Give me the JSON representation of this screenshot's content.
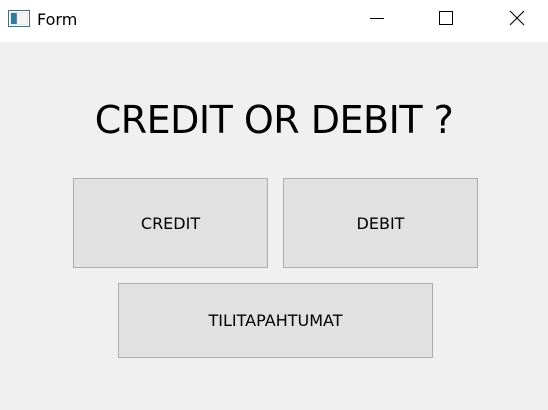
{
  "window": {
    "title": "Form",
    "icon": "form-window-icon",
    "controls": [
      "minimize-icon",
      "maximize-icon",
      "close-icon"
    ]
  },
  "main": {
    "heading": "CREDIT OR DEBIT ?",
    "buttons": {
      "credit": "CREDIT",
      "debit": "DEBIT",
      "transactions": "TILITAPAHTUMAT"
    }
  },
  "colors": {
    "background": "#f0f0f0",
    "titlebar": "#ffffff",
    "button_face": "#e1e1e1",
    "button_border": "#adadad"
  }
}
